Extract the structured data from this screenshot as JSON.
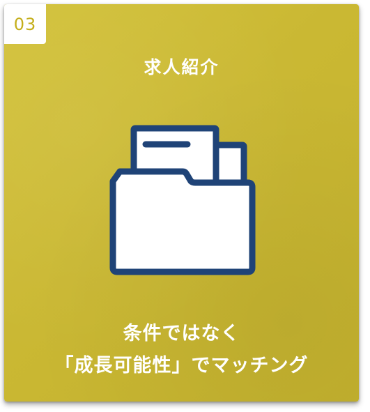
{
  "card": {
    "number": "03",
    "title": "求人紹介",
    "icon": "folder-with-documents-icon",
    "description_line1": "条件ではなく",
    "description_line2": "「成長可能性」でマッチング"
  },
  "colors": {
    "card_background": "#cbb934",
    "badge_text": "#c4ae1a",
    "icon_stroke": "#1f4377",
    "text": "#ffffff"
  }
}
